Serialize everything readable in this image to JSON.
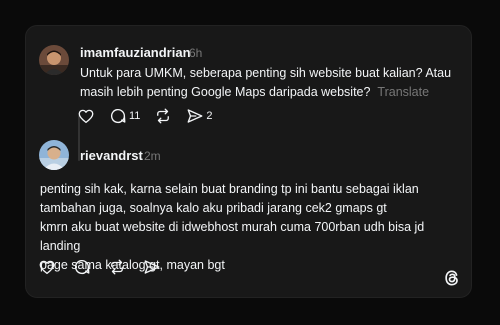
{
  "post": {
    "username": "imamfauziandrian",
    "time": "6h",
    "text_line1": "Untuk para UMKM, seberapa penting sih website buat kalian? Atau",
    "text_line2": "masih lebih penting Google Maps daripada website?",
    "translate_label": "Translate",
    "actions": {
      "like_icon": "heart-icon",
      "reply_icon": "comment-icon",
      "reply_count": "11",
      "repost_icon": "repost-icon",
      "share_icon": "send-icon",
      "share_count": "2"
    }
  },
  "reply": {
    "username": "rievandrst",
    "time": "2m",
    "lines": [
      "penting sih kak, karna selain buat branding tp ini bantu sebagai iklan",
      "tambahan juga, soalnya kalo aku pribadi jarang cek2 gmaps gt",
      "kmrn aku buat website di idwebhost murah cuma 700rban udh bisa jd landing",
      "page sama katalog gt, mayan bgt"
    ],
    "actions": {
      "like_icon": "heart-icon",
      "reply_icon": "comment-icon",
      "repost_icon": "repost-icon",
      "share_icon": "send-icon"
    }
  },
  "brand_icon": "threads-logo-icon",
  "colors": {
    "background": "#0a0a0a",
    "card": "#181818",
    "primary_text": "#f3f5f7",
    "secondary_text": "#777777"
  }
}
